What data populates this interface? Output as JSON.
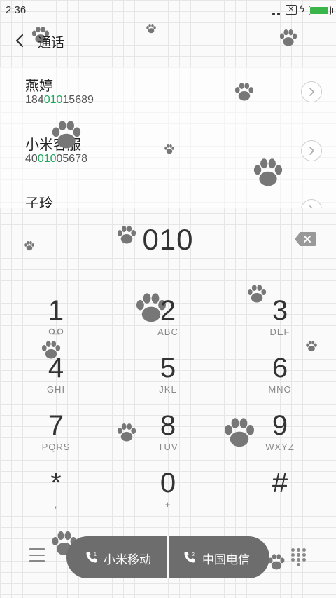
{
  "status_bar": {
    "time": "2:36"
  },
  "header": {
    "title": "通话"
  },
  "contacts": [
    {
      "name": "燕婷",
      "number_prefix": "184",
      "number_match": "010",
      "number_suffix": "15689"
    },
    {
      "name": "小米客服",
      "number_prefix": "40",
      "number_match": "010",
      "number_suffix": "05678"
    },
    {
      "name": "子玲",
      "number_prefix": "",
      "number_match": "",
      "number_suffix": ""
    }
  ],
  "dialer": {
    "entered_digits": "010"
  },
  "keys": [
    {
      "digit": "1",
      "letters": ""
    },
    {
      "digit": "2",
      "letters": "ABC"
    },
    {
      "digit": "3",
      "letters": "DEF"
    },
    {
      "digit": "4",
      "letters": "GHI"
    },
    {
      "digit": "5",
      "letters": "JKL"
    },
    {
      "digit": "6",
      "letters": "MNO"
    },
    {
      "digit": "7",
      "letters": "PQRS"
    },
    {
      "digit": "8",
      "letters": "TUV"
    },
    {
      "digit": "9",
      "letters": "WXYZ"
    },
    {
      "digit": "*",
      "letters": ","
    },
    {
      "digit": "0",
      "letters": "+"
    },
    {
      "digit": "#",
      "letters": ""
    }
  ],
  "call_buttons": {
    "sim1": {
      "label": "小米移动",
      "sim_index": "1"
    },
    "sim2": {
      "label": "中国电信",
      "sim_index": "2"
    }
  },
  "colors": {
    "match_highlight": "#1ca75a",
    "call_pill": "#6d6d6d",
    "battery": "#39b54a"
  }
}
